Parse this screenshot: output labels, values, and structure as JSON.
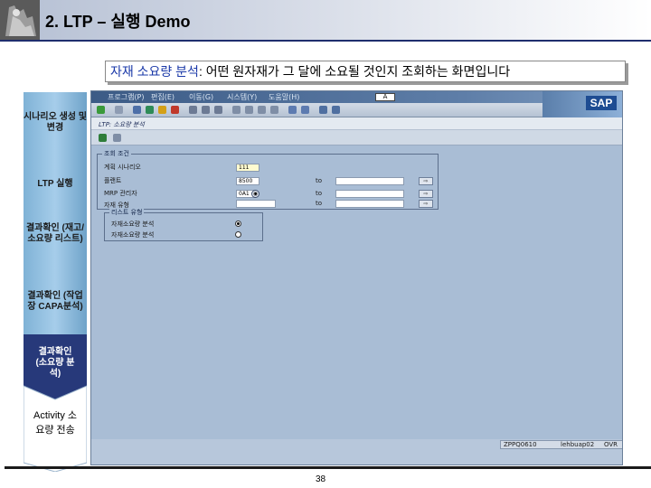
{
  "slide": {
    "title": "2. LTP – 실행 Demo",
    "caption_highlight": "자재 소요량 분석",
    "caption_rest": ": 어떤 원자재가 그 달에 소요될 것인지 조회하는 화면입니다",
    "page_number": "38"
  },
  "steps": [
    {
      "label": "시나리오 생성 및 변경",
      "active": false
    },
    {
      "label": "LTP 실행",
      "active": false
    },
    {
      "label": "결과확인 (재고/소요량 리스트)",
      "active": false
    },
    {
      "label": "결과확인 (작업장 CAPA분석)",
      "active": false
    },
    {
      "label": "결과확인 (소요량 분석)",
      "active": true
    },
    {
      "label": "Activity 소요량 전송",
      "active": false
    }
  ],
  "sap": {
    "menu": [
      "프로그램(P)",
      "편집(E)",
      "이동(G)",
      "시스템(Y)",
      "도움말(H)"
    ],
    "command_field": "A",
    "logo": "SAP",
    "screen_title": "LTP: 소요량 분석",
    "group_main": {
      "label": "조회 조건",
      "fields": [
        {
          "label": "계획 시나리오",
          "value": "111"
        },
        {
          "label": "플랜트",
          "value": "8500"
        },
        {
          "label": "MRP 관리자",
          "value": "0A1"
        },
        {
          "label": "자재 유형",
          "value": ""
        }
      ],
      "to_label": "to"
    },
    "group_list": {
      "label": "리스트 유형",
      "options": [
        {
          "label": "자재소요량 분석",
          "selected": true
        },
        {
          "label": "자재소요량 분석",
          "selected": false
        }
      ]
    },
    "status": {
      "transaction": "ZPPQ0610",
      "server": "lehbuap02",
      "mode": "OVR"
    }
  }
}
